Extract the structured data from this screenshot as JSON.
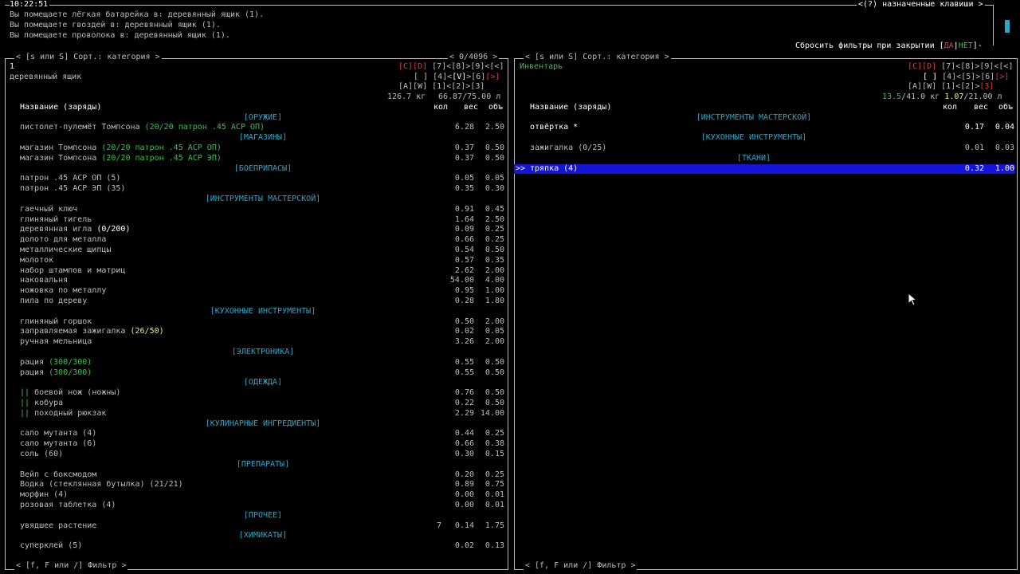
{
  "clock": "10:22:51",
  "keybindings": "<(?) назначенные клавиши >",
  "messages": [
    "Вы помещаете лёгкая батарейка в: деревянный ящик (1).",
    "Вы помещаете гвоздей в: деревянный ящик (1).",
    "Вы помещаете проволока в: деревянный ящик (1)."
  ],
  "reset_filters": {
    "label": "Сбросить фильтры при закрытии [",
    "yes": "ДА",
    "sep": "|",
    "no": "НЕТ",
    "end": "]-"
  },
  "left": {
    "sort_hint": "< [s или S] Сорт.: категория >",
    "counter": "< 0/4096 >",
    "index": "1",
    "location": "деревянный ящик",
    "slots": {
      "r1": [
        "[C]",
        "[D]",
        "[7]<[8]>[9]<[<]"
      ],
      "r2": [
        "[ ]",
        "[4]<",
        "[V]",
        ">[6]",
        "[>]"
      ],
      "r3": [
        "[A][W]",
        "[1]<[2]>[3]"
      ]
    },
    "weight": "126.7 кг",
    "volume": "66.87/75.00 л",
    "header": {
      "name": "Название (заряды)",
      "qty": "кол",
      "w": "вес",
      "v": "объ"
    },
    "filter": "< [f, F или /] Фильтр >",
    "rows": [
      {
        "cat": "[ОРУЖИЕ]"
      },
      {
        "name": "пистолет-пулемёт Томпсона ",
        "extra": "(20/20 патрон .45 АСР ОП)",
        "extra_color": "green",
        "qty": "",
        "w": "6.28",
        "v": "2.50"
      },
      {
        "cat": "[МАГАЗИНЫ]"
      },
      {
        "name": "магазин Томпсона ",
        "extra": "(20/20 патрон .45 АСР ОП)",
        "extra_color": "green",
        "qty": "",
        "w": "0.37",
        "v": "0.50"
      },
      {
        "name": "магазин Томпсона ",
        "extra": "(20/20 патрон .45 АСР ЭП)",
        "extra_color": "green",
        "qty": "",
        "w": "0.37",
        "v": "0.50"
      },
      {
        "cat": "[БОЕПРИПАСЫ]"
      },
      {
        "name": "патрон .45 АСР ОП (5)",
        "extra": "",
        "qty": "",
        "w": "0.05",
        "v": "0.05"
      },
      {
        "name": "патрон .45 АСР ЭП (35)",
        "extra": "",
        "qty": "",
        "w": "0.35",
        "v": "0.30"
      },
      {
        "cat": "[ИНСТРУМЕНТЫ МАСТЕРСКОЙ]"
      },
      {
        "name": "гаечный ключ",
        "extra": "",
        "qty": "",
        "w": "0.91",
        "v": "0.45"
      },
      {
        "name": "глиняный тигель",
        "extra": "",
        "qty": "",
        "w": "1.64",
        "v": "2.50"
      },
      {
        "name": "деревянная игла ",
        "extra": "(0/200)",
        "extra_color": "white",
        "qty": "",
        "w": "0.09",
        "v": "0.25"
      },
      {
        "name": "долото для металла",
        "extra": "",
        "qty": "",
        "w": "0.66",
        "v": "0.25"
      },
      {
        "name": "металлические щипцы",
        "extra": "",
        "qty": "",
        "w": "0.54",
        "v": "0.50"
      },
      {
        "name": "молоток",
        "extra": "",
        "qty": "",
        "w": "0.57",
        "v": "0.35"
      },
      {
        "name": "набор штампов и матриц",
        "extra": "",
        "qty": "",
        "w": "2.62",
        "v": "2.00"
      },
      {
        "name": "наковальня",
        "extra": "",
        "qty": "",
        "w": "54.00",
        "v": "4.00"
      },
      {
        "name": "ножовка по металлу",
        "extra": "",
        "qty": "",
        "w": "0.95",
        "v": "1.00"
      },
      {
        "name": "пила по дереву",
        "extra": "",
        "qty": "",
        "w": "0.28",
        "v": "1.80"
      },
      {
        "cat": "[КУХОННЫЕ ИНСТРУМЕНТЫ]"
      },
      {
        "name": "глиняный горшок",
        "extra": "",
        "qty": "",
        "w": "0.50",
        "v": "2.00"
      },
      {
        "name": "заправляемая зажигалка ",
        "extra": "(26/50)",
        "extra_color": "yellow",
        "qty": "",
        "w": "0.02",
        "v": "0.05"
      },
      {
        "name": "ручная мельница",
        "extra": "",
        "qty": "",
        "w": "3.26",
        "v": "2.00"
      },
      {
        "cat": "[ЭЛЕКТРОНИКА]"
      },
      {
        "name": "рация ",
        "extra": "(300/300)",
        "extra_color": "green",
        "qty": "",
        "w": "0.55",
        "v": "0.50"
      },
      {
        "name": "рация ",
        "extra": "(300/300)",
        "extra_color": "green",
        "qty": "",
        "w": "0.55",
        "v": "0.50"
      },
      {
        "cat": "[ОДЕЖДА]"
      },
      {
        "mark": "||",
        "name": " боевой нож (ножны)",
        "extra": "",
        "qty": "",
        "w": "0.76",
        "v": "0.50"
      },
      {
        "mark": "||",
        "name": " кобура",
        "extra": "",
        "qty": "",
        "w": "0.22",
        "v": "0.50"
      },
      {
        "mark": "||",
        "name": " походный рюкзак",
        "extra": "",
        "qty": "",
        "w": "2.29",
        "v": "14.00"
      },
      {
        "cat": "[КУЛИНАРНЫЕ ИНГРЕДИЕНТЫ]"
      },
      {
        "name": "сало мутанта (4)",
        "extra": "",
        "qty": "",
        "w": "0.44",
        "v": "0.25"
      },
      {
        "name": "сало мутанта (6)",
        "extra": "",
        "qty": "",
        "w": "0.66",
        "v": "0.38"
      },
      {
        "name": "соль (60)",
        "extra": "",
        "qty": "",
        "w": "0.30",
        "v": "0.15"
      },
      {
        "cat": "[ПРЕПАРАТЫ]"
      },
      {
        "name": "Вейп с боксмодом",
        "extra": "",
        "qty": "",
        "w": "0.20",
        "v": "0.25"
      },
      {
        "name": "Водка (стеклянная бутылка) (21/21)",
        "extra": "",
        "qty": "",
        "w": "0.89",
        "v": "0.75"
      },
      {
        "name": "морфин (4)",
        "extra": "",
        "qty": "",
        "w": "0.00",
        "v": "0.01"
      },
      {
        "name": "розовая таблетка (4)",
        "extra": "",
        "qty": "",
        "w": "0.00",
        "v": "0.01"
      },
      {
        "cat": "[ПРОЧЕЕ]"
      },
      {
        "name": "увядшее растение",
        "extra": "",
        "qty": "7",
        "w": "0.14",
        "v": "1.75"
      },
      {
        "cat": "[ХИМИКАТЫ]"
      },
      {
        "name": "суперклей (5)",
        "extra": "",
        "qty": "",
        "w": "0.02",
        "v": "0.13"
      }
    ]
  },
  "right": {
    "sort_hint": "< [s или S] Сорт.: категория >",
    "location": "Инвентарь",
    "slots": {
      "r1": [
        "[C]",
        "[D]",
        "[7]<[8]>[9]<[<]"
      ],
      "r2": [
        "[ ]",
        "[4]<[5]>[6]",
        "[>]"
      ],
      "r3": [
        "[A][W]",
        "[1]<[2]>",
        "[3]"
      ]
    },
    "weight_cur": "13.5",
    "weight_max": "/41.0 кг",
    "vol_cur": "1.07",
    "vol_max": "/21.00 л",
    "header": {
      "name": "Название (заряды)",
      "qty": "кол",
      "w": "вес",
      "v": "объ"
    },
    "filter": "< [f, F или /] Фильтр >",
    "rows": [
      {
        "cat": "[ИНСТРУМЕНТЫ МАСТЕРСКОЙ]"
      },
      {
        "name": "отвёртка *",
        "white": true,
        "w": "0.17",
        "v": "0.04"
      },
      {
        "cat": "[КУХОННЫЕ ИНСТРУМЕНТЫ]"
      },
      {
        "name": "зажигалка (0/25)",
        "w": "0.01",
        "v": "0.03"
      },
      {
        "cat": "[ТКАНИ]"
      },
      {
        "name": "тряпка (4)",
        "selected": true,
        "cursor": ">>",
        "w": "0.32",
        "v": "1.00"
      }
    ]
  }
}
